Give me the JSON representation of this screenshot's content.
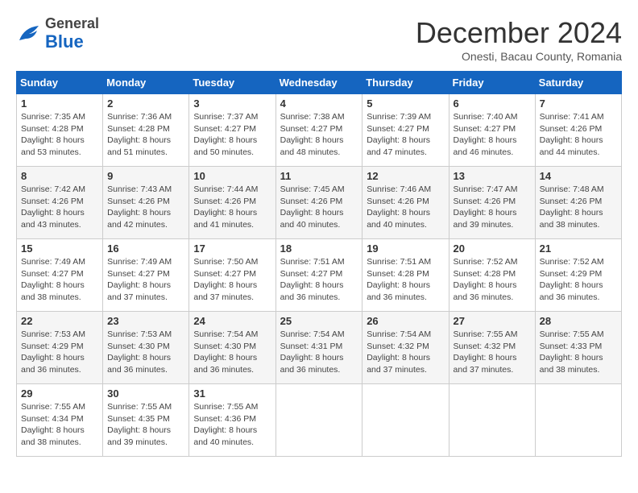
{
  "header": {
    "logo_general": "General",
    "logo_blue": "Blue",
    "month": "December 2024",
    "location": "Onesti, Bacau County, Romania"
  },
  "weekdays": [
    "Sunday",
    "Monday",
    "Tuesday",
    "Wednesday",
    "Thursday",
    "Friday",
    "Saturday"
  ],
  "weeks": [
    [
      {
        "day": "1",
        "sunrise": "Sunrise: 7:35 AM",
        "sunset": "Sunset: 4:28 PM",
        "daylight": "Daylight: 8 hours and 53 minutes."
      },
      {
        "day": "2",
        "sunrise": "Sunrise: 7:36 AM",
        "sunset": "Sunset: 4:28 PM",
        "daylight": "Daylight: 8 hours and 51 minutes."
      },
      {
        "day": "3",
        "sunrise": "Sunrise: 7:37 AM",
        "sunset": "Sunset: 4:27 PM",
        "daylight": "Daylight: 8 hours and 50 minutes."
      },
      {
        "day": "4",
        "sunrise": "Sunrise: 7:38 AM",
        "sunset": "Sunset: 4:27 PM",
        "daylight": "Daylight: 8 hours and 48 minutes."
      },
      {
        "day": "5",
        "sunrise": "Sunrise: 7:39 AM",
        "sunset": "Sunset: 4:27 PM",
        "daylight": "Daylight: 8 hours and 47 minutes."
      },
      {
        "day": "6",
        "sunrise": "Sunrise: 7:40 AM",
        "sunset": "Sunset: 4:27 PM",
        "daylight": "Daylight: 8 hours and 46 minutes."
      },
      {
        "day": "7",
        "sunrise": "Sunrise: 7:41 AM",
        "sunset": "Sunset: 4:26 PM",
        "daylight": "Daylight: 8 hours and 44 minutes."
      }
    ],
    [
      {
        "day": "8",
        "sunrise": "Sunrise: 7:42 AM",
        "sunset": "Sunset: 4:26 PM",
        "daylight": "Daylight: 8 hours and 43 minutes."
      },
      {
        "day": "9",
        "sunrise": "Sunrise: 7:43 AM",
        "sunset": "Sunset: 4:26 PM",
        "daylight": "Daylight: 8 hours and 42 minutes."
      },
      {
        "day": "10",
        "sunrise": "Sunrise: 7:44 AM",
        "sunset": "Sunset: 4:26 PM",
        "daylight": "Daylight: 8 hours and 41 minutes."
      },
      {
        "day": "11",
        "sunrise": "Sunrise: 7:45 AM",
        "sunset": "Sunset: 4:26 PM",
        "daylight": "Daylight: 8 hours and 40 minutes."
      },
      {
        "day": "12",
        "sunrise": "Sunrise: 7:46 AM",
        "sunset": "Sunset: 4:26 PM",
        "daylight": "Daylight: 8 hours and 40 minutes."
      },
      {
        "day": "13",
        "sunrise": "Sunrise: 7:47 AM",
        "sunset": "Sunset: 4:26 PM",
        "daylight": "Daylight: 8 hours and 39 minutes."
      },
      {
        "day": "14",
        "sunrise": "Sunrise: 7:48 AM",
        "sunset": "Sunset: 4:26 PM",
        "daylight": "Daylight: 8 hours and 38 minutes."
      }
    ],
    [
      {
        "day": "15",
        "sunrise": "Sunrise: 7:49 AM",
        "sunset": "Sunset: 4:27 PM",
        "daylight": "Daylight: 8 hours and 38 minutes."
      },
      {
        "day": "16",
        "sunrise": "Sunrise: 7:49 AM",
        "sunset": "Sunset: 4:27 PM",
        "daylight": "Daylight: 8 hours and 37 minutes."
      },
      {
        "day": "17",
        "sunrise": "Sunrise: 7:50 AM",
        "sunset": "Sunset: 4:27 PM",
        "daylight": "Daylight: 8 hours and 37 minutes."
      },
      {
        "day": "18",
        "sunrise": "Sunrise: 7:51 AM",
        "sunset": "Sunset: 4:27 PM",
        "daylight": "Daylight: 8 hours and 36 minutes."
      },
      {
        "day": "19",
        "sunrise": "Sunrise: 7:51 AM",
        "sunset": "Sunset: 4:28 PM",
        "daylight": "Daylight: 8 hours and 36 minutes."
      },
      {
        "day": "20",
        "sunrise": "Sunrise: 7:52 AM",
        "sunset": "Sunset: 4:28 PM",
        "daylight": "Daylight: 8 hours and 36 minutes."
      },
      {
        "day": "21",
        "sunrise": "Sunrise: 7:52 AM",
        "sunset": "Sunset: 4:29 PM",
        "daylight": "Daylight: 8 hours and 36 minutes."
      }
    ],
    [
      {
        "day": "22",
        "sunrise": "Sunrise: 7:53 AM",
        "sunset": "Sunset: 4:29 PM",
        "daylight": "Daylight: 8 hours and 36 minutes."
      },
      {
        "day": "23",
        "sunrise": "Sunrise: 7:53 AM",
        "sunset": "Sunset: 4:30 PM",
        "daylight": "Daylight: 8 hours and 36 minutes."
      },
      {
        "day": "24",
        "sunrise": "Sunrise: 7:54 AM",
        "sunset": "Sunset: 4:30 PM",
        "daylight": "Daylight: 8 hours and 36 minutes."
      },
      {
        "day": "25",
        "sunrise": "Sunrise: 7:54 AM",
        "sunset": "Sunset: 4:31 PM",
        "daylight": "Daylight: 8 hours and 36 minutes."
      },
      {
        "day": "26",
        "sunrise": "Sunrise: 7:54 AM",
        "sunset": "Sunset: 4:32 PM",
        "daylight": "Daylight: 8 hours and 37 minutes."
      },
      {
        "day": "27",
        "sunrise": "Sunrise: 7:55 AM",
        "sunset": "Sunset: 4:32 PM",
        "daylight": "Daylight: 8 hours and 37 minutes."
      },
      {
        "day": "28",
        "sunrise": "Sunrise: 7:55 AM",
        "sunset": "Sunset: 4:33 PM",
        "daylight": "Daylight: 8 hours and 38 minutes."
      }
    ],
    [
      {
        "day": "29",
        "sunrise": "Sunrise: 7:55 AM",
        "sunset": "Sunset: 4:34 PM",
        "daylight": "Daylight: 8 hours and 38 minutes."
      },
      {
        "day": "30",
        "sunrise": "Sunrise: 7:55 AM",
        "sunset": "Sunset: 4:35 PM",
        "daylight": "Daylight: 8 hours and 39 minutes."
      },
      {
        "day": "31",
        "sunrise": "Sunrise: 7:55 AM",
        "sunset": "Sunset: 4:36 PM",
        "daylight": "Daylight: 8 hours and 40 minutes."
      },
      null,
      null,
      null,
      null
    ]
  ]
}
